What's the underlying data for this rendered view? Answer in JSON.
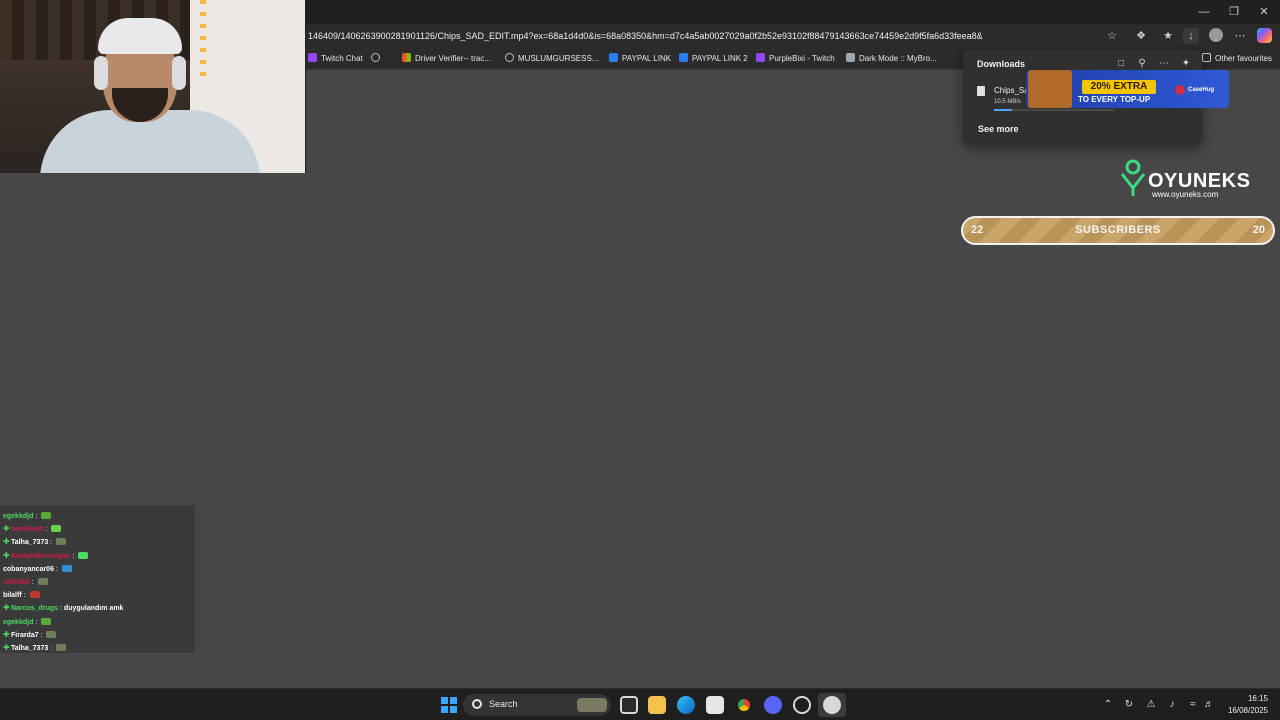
{
  "window": {
    "controls": [
      "minimize-icon",
      "restore-icon",
      "close-icon"
    ]
  },
  "browser": {
    "url": "146409/1406263900281901126/Chips_SAD_EDIT.mp4?ex=68a1d4d0&is=68a08350&hm=d7c4a5ab0027029a0f2b52e93102f88479143663ce74459e2d9f5fa6d33feea8&",
    "favourites": [
      {
        "label": "Twitch Chat",
        "icon": "twitch-icon",
        "color": "#9146ff"
      },
      {
        "label": "",
        "icon": "globe-icon",
        "color": "#bbbbbb"
      },
      {
        "label": "Driver Verifier-- trac...",
        "icon": "microsoft-icon",
        "color": "#f35325"
      },
      {
        "label": "MUSLUMGURSESS...",
        "icon": "globe-icon",
        "color": "#bbbbbb"
      },
      {
        "label": "PAYPAL LINK",
        "icon": "paypal-icon",
        "color": "#2a7ef0"
      },
      {
        "label": "PAYPAL LINK 2",
        "icon": "paypal-icon",
        "color": "#2a7ef0"
      },
      {
        "label": "PurpleBixi - Twitch",
        "icon": "twitch-icon",
        "color": "#9146ff"
      },
      {
        "label": "Dark Mode :: MyBro...",
        "icon": "puzzle-icon",
        "color": "#9aa7b5"
      }
    ],
    "other_favourites": "Other favourites"
  },
  "downloads": {
    "title": "Downloads",
    "file_name": "Chips_SA",
    "speed": "10.5 MB/s",
    "progress": 0.15,
    "see_more": "See more"
  },
  "ad": {
    "headline": "20% EXTRA",
    "subline": "TO EVERY TOP-UP",
    "brand": "CaseHug"
  },
  "sponsor": {
    "name": "OYUNEKS",
    "url": "www.oyuneks.com"
  },
  "sub_goal": {
    "current": "22",
    "label": "SUBSCRIBERS",
    "target": "20"
  },
  "chat": [
    {
      "user": "egekkdjd",
      "color": "#4cd964",
      "text": "",
      "emote": "#5aa83a",
      "badge": false
    },
    {
      "user": "herakles0",
      "color": "#d11a4b",
      "text": "",
      "emote": "#6bd04a",
      "badge": true
    },
    {
      "user": "Talha_7373",
      "color": "#ffffff",
      "text": "",
      "emote": "#6e7f5a",
      "badge": true
    },
    {
      "user": "KahtaliMormegtar",
      "color": "#d11a4b",
      "text": "",
      "emote": "#4cd964",
      "badge": true
    },
    {
      "user": "cobanyancar06",
      "color": "#ffffff",
      "text": "",
      "emote": "#2f8fd8",
      "badge": false
    },
    {
      "user": "ratfi4ikk",
      "color": "#d11a4b",
      "text": "",
      "emote": "#6e7f5a",
      "badge": false
    },
    {
      "user": "bilalff",
      "color": "#ffffff",
      "text": "",
      "emote": "#c0392b",
      "badge": false
    },
    {
      "user": "Narcos_drugs",
      "color": "#4cd964",
      "text": "duygulandım amk",
      "emote": "",
      "badge": true
    },
    {
      "user": "egekkdjd",
      "color": "#4cd964",
      "text": "",
      "emote": "#5aa83a",
      "badge": false
    },
    {
      "user": "Firarda7",
      "color": "#ffffff",
      "text": "",
      "emote": "#6e7f5a",
      "badge": true
    },
    {
      "user": "Talha_7373",
      "color": "#ffffff",
      "text": "",
      "emote": "#6e7f5a",
      "badge": true
    }
  ],
  "taskbar": {
    "search_label": "Search",
    "apps": [
      "task-view-icon",
      "file-explorer-icon",
      "edge-icon",
      "store-icon",
      "chrome-icon",
      "discord-icon",
      "steam-alt-icon",
      "steam-icon"
    ],
    "time": "16:15",
    "date": "16/08/2025"
  }
}
